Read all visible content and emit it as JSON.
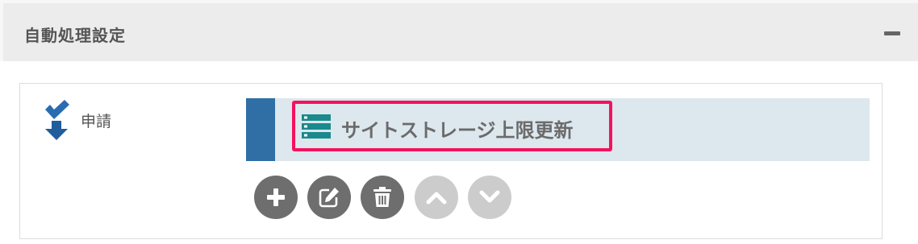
{
  "panel": {
    "title": "自動処理設定",
    "collapse_icon": "minus-icon"
  },
  "step": {
    "label": "申請",
    "icon": "check-down-arrow-icon",
    "icon_color": "#2b6cb0"
  },
  "process": {
    "label": "サイトストレージ上限更新",
    "icon": "server-list-icon",
    "icon_color": "#1a8a8c",
    "bar_color": "#2f6fa5",
    "highlight_color": "#f5115e"
  },
  "actions": [
    {
      "name": "add",
      "icon": "plus-icon",
      "enabled": true
    },
    {
      "name": "edit",
      "icon": "edit-icon",
      "enabled": true
    },
    {
      "name": "delete",
      "icon": "trash-icon",
      "enabled": true
    },
    {
      "name": "move-up",
      "icon": "chevron-up-icon",
      "enabled": false
    },
    {
      "name": "move-down",
      "icon": "chevron-down-icon",
      "enabled": false
    }
  ]
}
